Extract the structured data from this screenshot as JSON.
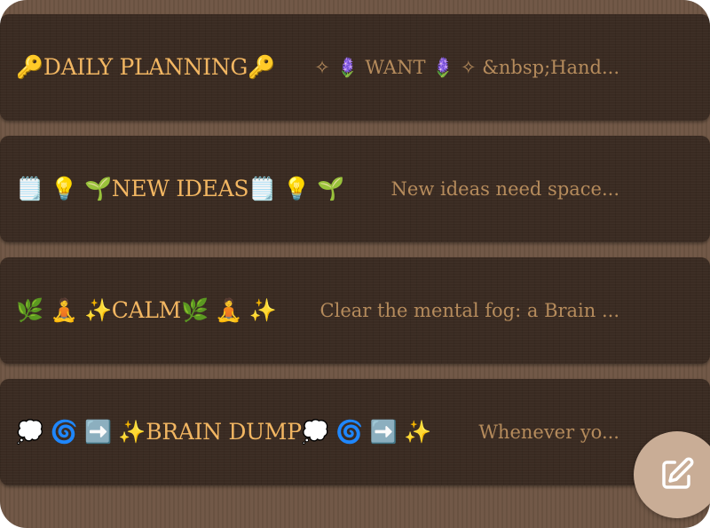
{
  "notes": [
    {
      "title": "🔑DAILY PLANNING🔑",
      "preview": "✧ 🪻 WANT 🪻 ✧ &nbsp;Hand..."
    },
    {
      "title": "🗒️ 💡 🌱NEW IDEAS🗒️ 💡 🌱",
      "preview": "New ideas need space..."
    },
    {
      "title": "🌿 🧘 ✨CALM🌿 🧘 ✨",
      "preview": "Clear the mental fog: a Brain ..."
    },
    {
      "title": "💭 🌀 ➡️ ✨BRAIN DUMP💭 🌀 ➡️ ✨",
      "preview": "Whenever yo..."
    }
  ],
  "fab": {
    "icon": "edit-note-icon"
  },
  "colors": {
    "card_bg": "#3a2b22",
    "page_bg": "#6f5644",
    "title": "#f2b662",
    "preview": "#b58b5c",
    "fab_bg": "#c9ad96"
  }
}
